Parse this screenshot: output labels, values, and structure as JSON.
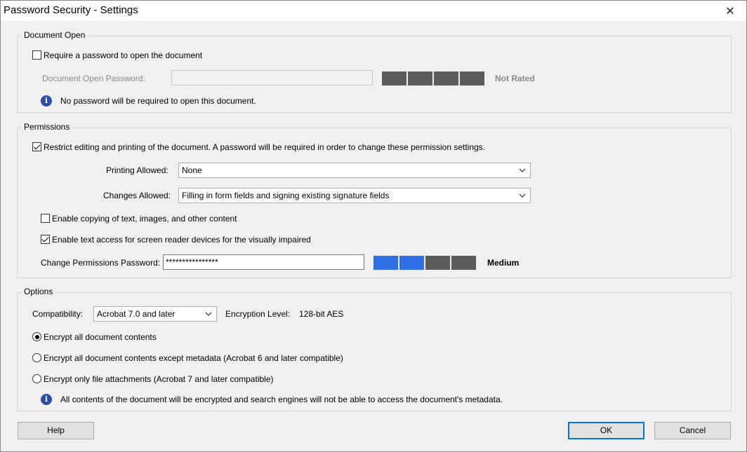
{
  "window": {
    "title": "Password Security - Settings",
    "close_glyph": "✕"
  },
  "document_open": {
    "group_label": "Document Open",
    "require_password_label": "Require a password to open the document",
    "require_password_checked": false,
    "password_label": "Document Open Password:",
    "password_value": "",
    "strength_rating": "Not Rated",
    "strength_level": 0,
    "info_text": "No password will be required to open this document."
  },
  "permissions": {
    "group_label": "Permissions",
    "restrict_label": "Restrict editing and printing of the document. A password will be required in order to change these permission settings.",
    "restrict_checked": true,
    "printing_label": "Printing Allowed:",
    "printing_value": "None",
    "changes_label": "Changes Allowed:",
    "changes_value": "Filling in form fields and signing existing signature fields",
    "copy_label": "Enable copying of text, images, and other content",
    "copy_checked": false,
    "screen_reader_label": "Enable text access for screen reader devices for the visually impaired",
    "screen_reader_checked": true,
    "change_password_label": "Change Permissions Password:",
    "change_password_value": "****************",
    "strength_rating": "Medium",
    "strength_level": 2
  },
  "options": {
    "group_label": "Options",
    "compat_label": "Compatibility:",
    "compat_value": "Acrobat 7.0 and later",
    "encryption_label": "Encryption  Level:",
    "encryption_value": "128-bit AES",
    "radio_all": "Encrypt all document contents",
    "radio_except_metadata": "Encrypt all document contents except metadata (Acrobat 6 and later compatible)",
    "radio_attachments": "Encrypt only file attachments (Acrobat 7 and later compatible)",
    "selected_radio": "all",
    "info_text": "All contents of the document will be encrypted and search engines will not be able to access the document's metadata."
  },
  "buttons": {
    "help": "Help",
    "ok": "OK",
    "cancel": "Cancel"
  },
  "colors": {
    "meter_on": "#2f6fe6",
    "meter_off": "#5b5b5b",
    "info_icon": "#2b4ea8",
    "default_button_border": "#0078d7"
  }
}
